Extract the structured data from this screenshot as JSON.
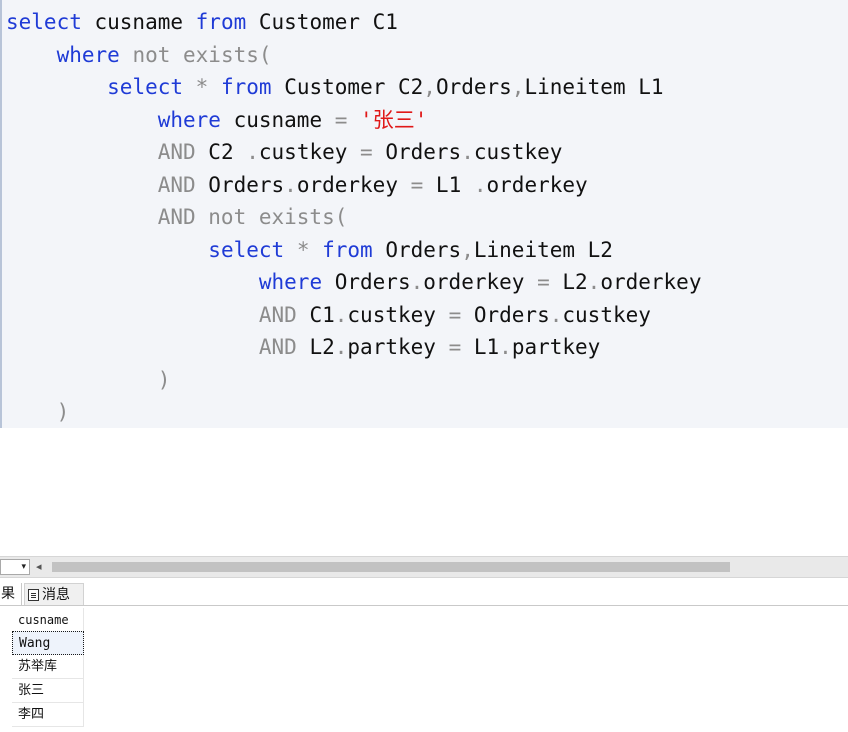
{
  "editor": {
    "lines": [
      [
        {
          "t": "select",
          "c": "kw"
        },
        {
          "t": " cusname ",
          "c": ""
        },
        {
          "t": "from",
          "c": "kw"
        },
        {
          "t": " Customer C1",
          "c": ""
        }
      ],
      [
        {
          "t": "    ",
          "c": ""
        },
        {
          "t": "where",
          "c": "kw"
        },
        {
          "t": " ",
          "c": ""
        },
        {
          "t": "not exists(",
          "c": "op"
        }
      ],
      [
        {
          "t": "        ",
          "c": ""
        },
        {
          "t": "select",
          "c": "kw"
        },
        {
          "t": " ",
          "c": ""
        },
        {
          "t": "*",
          "c": "op"
        },
        {
          "t": " ",
          "c": ""
        },
        {
          "t": "from",
          "c": "kw"
        },
        {
          "t": " Customer C2",
          "c": ""
        },
        {
          "t": ",",
          "c": "op"
        },
        {
          "t": "Orders",
          "c": ""
        },
        {
          "t": ",",
          "c": "op"
        },
        {
          "t": "Lineitem L1",
          "c": ""
        }
      ],
      [
        {
          "t": "            ",
          "c": ""
        },
        {
          "t": "where",
          "c": "kw"
        },
        {
          "t": " cusname ",
          "c": ""
        },
        {
          "t": "=",
          "c": "op"
        },
        {
          "t": " ",
          "c": ""
        },
        {
          "t": "'张三'",
          "c": "str"
        }
      ],
      [
        {
          "t": "            ",
          "c": ""
        },
        {
          "t": "AND",
          "c": "op"
        },
        {
          "t": " C2 ",
          "c": ""
        },
        {
          "t": ".",
          "c": "op"
        },
        {
          "t": "custkey ",
          "c": ""
        },
        {
          "t": "=",
          "c": "op"
        },
        {
          "t": " Orders",
          "c": ""
        },
        {
          "t": ".",
          "c": "op"
        },
        {
          "t": "custkey",
          "c": ""
        }
      ],
      [
        {
          "t": "            ",
          "c": ""
        },
        {
          "t": "AND",
          "c": "op"
        },
        {
          "t": " Orders",
          "c": ""
        },
        {
          "t": ".",
          "c": "op"
        },
        {
          "t": "orderkey ",
          "c": ""
        },
        {
          "t": "=",
          "c": "op"
        },
        {
          "t": " L1 ",
          "c": ""
        },
        {
          "t": ".",
          "c": "op"
        },
        {
          "t": "orderkey",
          "c": ""
        }
      ],
      [
        {
          "t": "            ",
          "c": ""
        },
        {
          "t": "AND not exists(",
          "c": "op"
        }
      ],
      [
        {
          "t": "                ",
          "c": ""
        },
        {
          "t": "select",
          "c": "kw"
        },
        {
          "t": " ",
          "c": ""
        },
        {
          "t": "*",
          "c": "op"
        },
        {
          "t": " ",
          "c": ""
        },
        {
          "t": "from",
          "c": "kw"
        },
        {
          "t": " Orders",
          "c": ""
        },
        {
          "t": ",",
          "c": "op"
        },
        {
          "t": "Lineitem L2",
          "c": ""
        }
      ],
      [
        {
          "t": "                    ",
          "c": ""
        },
        {
          "t": "where",
          "c": "kw"
        },
        {
          "t": " Orders",
          "c": ""
        },
        {
          "t": ".",
          "c": "op"
        },
        {
          "t": "orderkey ",
          "c": ""
        },
        {
          "t": "=",
          "c": "op"
        },
        {
          "t": " L2",
          "c": ""
        },
        {
          "t": ".",
          "c": "op"
        },
        {
          "t": "orderkey",
          "c": ""
        }
      ],
      [
        {
          "t": "                    ",
          "c": ""
        },
        {
          "t": "AND",
          "c": "op"
        },
        {
          "t": " C1",
          "c": ""
        },
        {
          "t": ".",
          "c": "op"
        },
        {
          "t": "custkey ",
          "c": ""
        },
        {
          "t": "=",
          "c": "op"
        },
        {
          "t": " Orders",
          "c": ""
        },
        {
          "t": ".",
          "c": "op"
        },
        {
          "t": "custkey",
          "c": ""
        }
      ],
      [
        {
          "t": "                    ",
          "c": ""
        },
        {
          "t": "AND",
          "c": "op"
        },
        {
          "t": " L2",
          "c": ""
        },
        {
          "t": ".",
          "c": "op"
        },
        {
          "t": "partkey ",
          "c": ""
        },
        {
          "t": "=",
          "c": "op"
        },
        {
          "t": " L1",
          "c": ""
        },
        {
          "t": ".",
          "c": "op"
        },
        {
          "t": "partkey",
          "c": ""
        }
      ],
      [
        {
          "t": "            ",
          "c": ""
        },
        {
          "t": ")",
          "c": "op"
        }
      ],
      [
        {
          "t": "    ",
          "c": ""
        },
        {
          "t": ")",
          "c": "op"
        }
      ]
    ],
    "colors": {
      "keyword": "#1f3bd6",
      "operator": "#8c8c8c",
      "string": "#e01818",
      "background": "#f3f5f9"
    }
  },
  "scrollbar": {
    "zoom_arrow": "▾",
    "left_arrow": "◂"
  },
  "tabs": {
    "results_label": "果",
    "messages_label": "消息",
    "messages_icon": "messages-icon"
  },
  "results": {
    "columns": [
      "cusname"
    ],
    "rows": [
      [
        "Wang"
      ],
      [
        "苏举库"
      ],
      [
        "张三"
      ],
      [
        "李四"
      ]
    ]
  }
}
